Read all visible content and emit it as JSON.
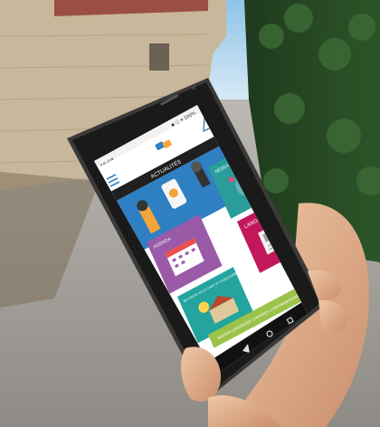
{
  "app": {
    "header_title": "ACTUALITÉS",
    "status_time": "16:08",
    "status_icons": "◆ ⓘ ▾ 100%",
    "brand_colors": {
      "news_blue": "#2f7fc3",
      "agenda_purple": "#9b5aa8",
      "social_teal": "#2a9d9b",
      "langres_pink": "#c2185b",
      "banner_green": "#9bc24a",
      "visit_teal": "#23a49e"
    }
  },
  "tiles": {
    "social": {
      "label": "RÉSEAUX SOCIAUX"
    },
    "agenda": {
      "label": "AGENDA"
    },
    "langres": {
      "label": "LANGRES & CO"
    },
    "visit": {
      "label": "MA VISITE VILLE D'ART ET D'HISTOIRE"
    },
    "banner": {
      "label": "MAISON LANGROISE CHIFFRES & INFORMATIONS PRATIQUES"
    }
  },
  "icons": {
    "menu": "hamburger-menu-icon",
    "bell": "notification-bell-icon",
    "logo": "speech-bubbles-logo-icon",
    "back": "nav-back-icon",
    "home": "nav-home-icon",
    "recent": "nav-recent-icon"
  }
}
